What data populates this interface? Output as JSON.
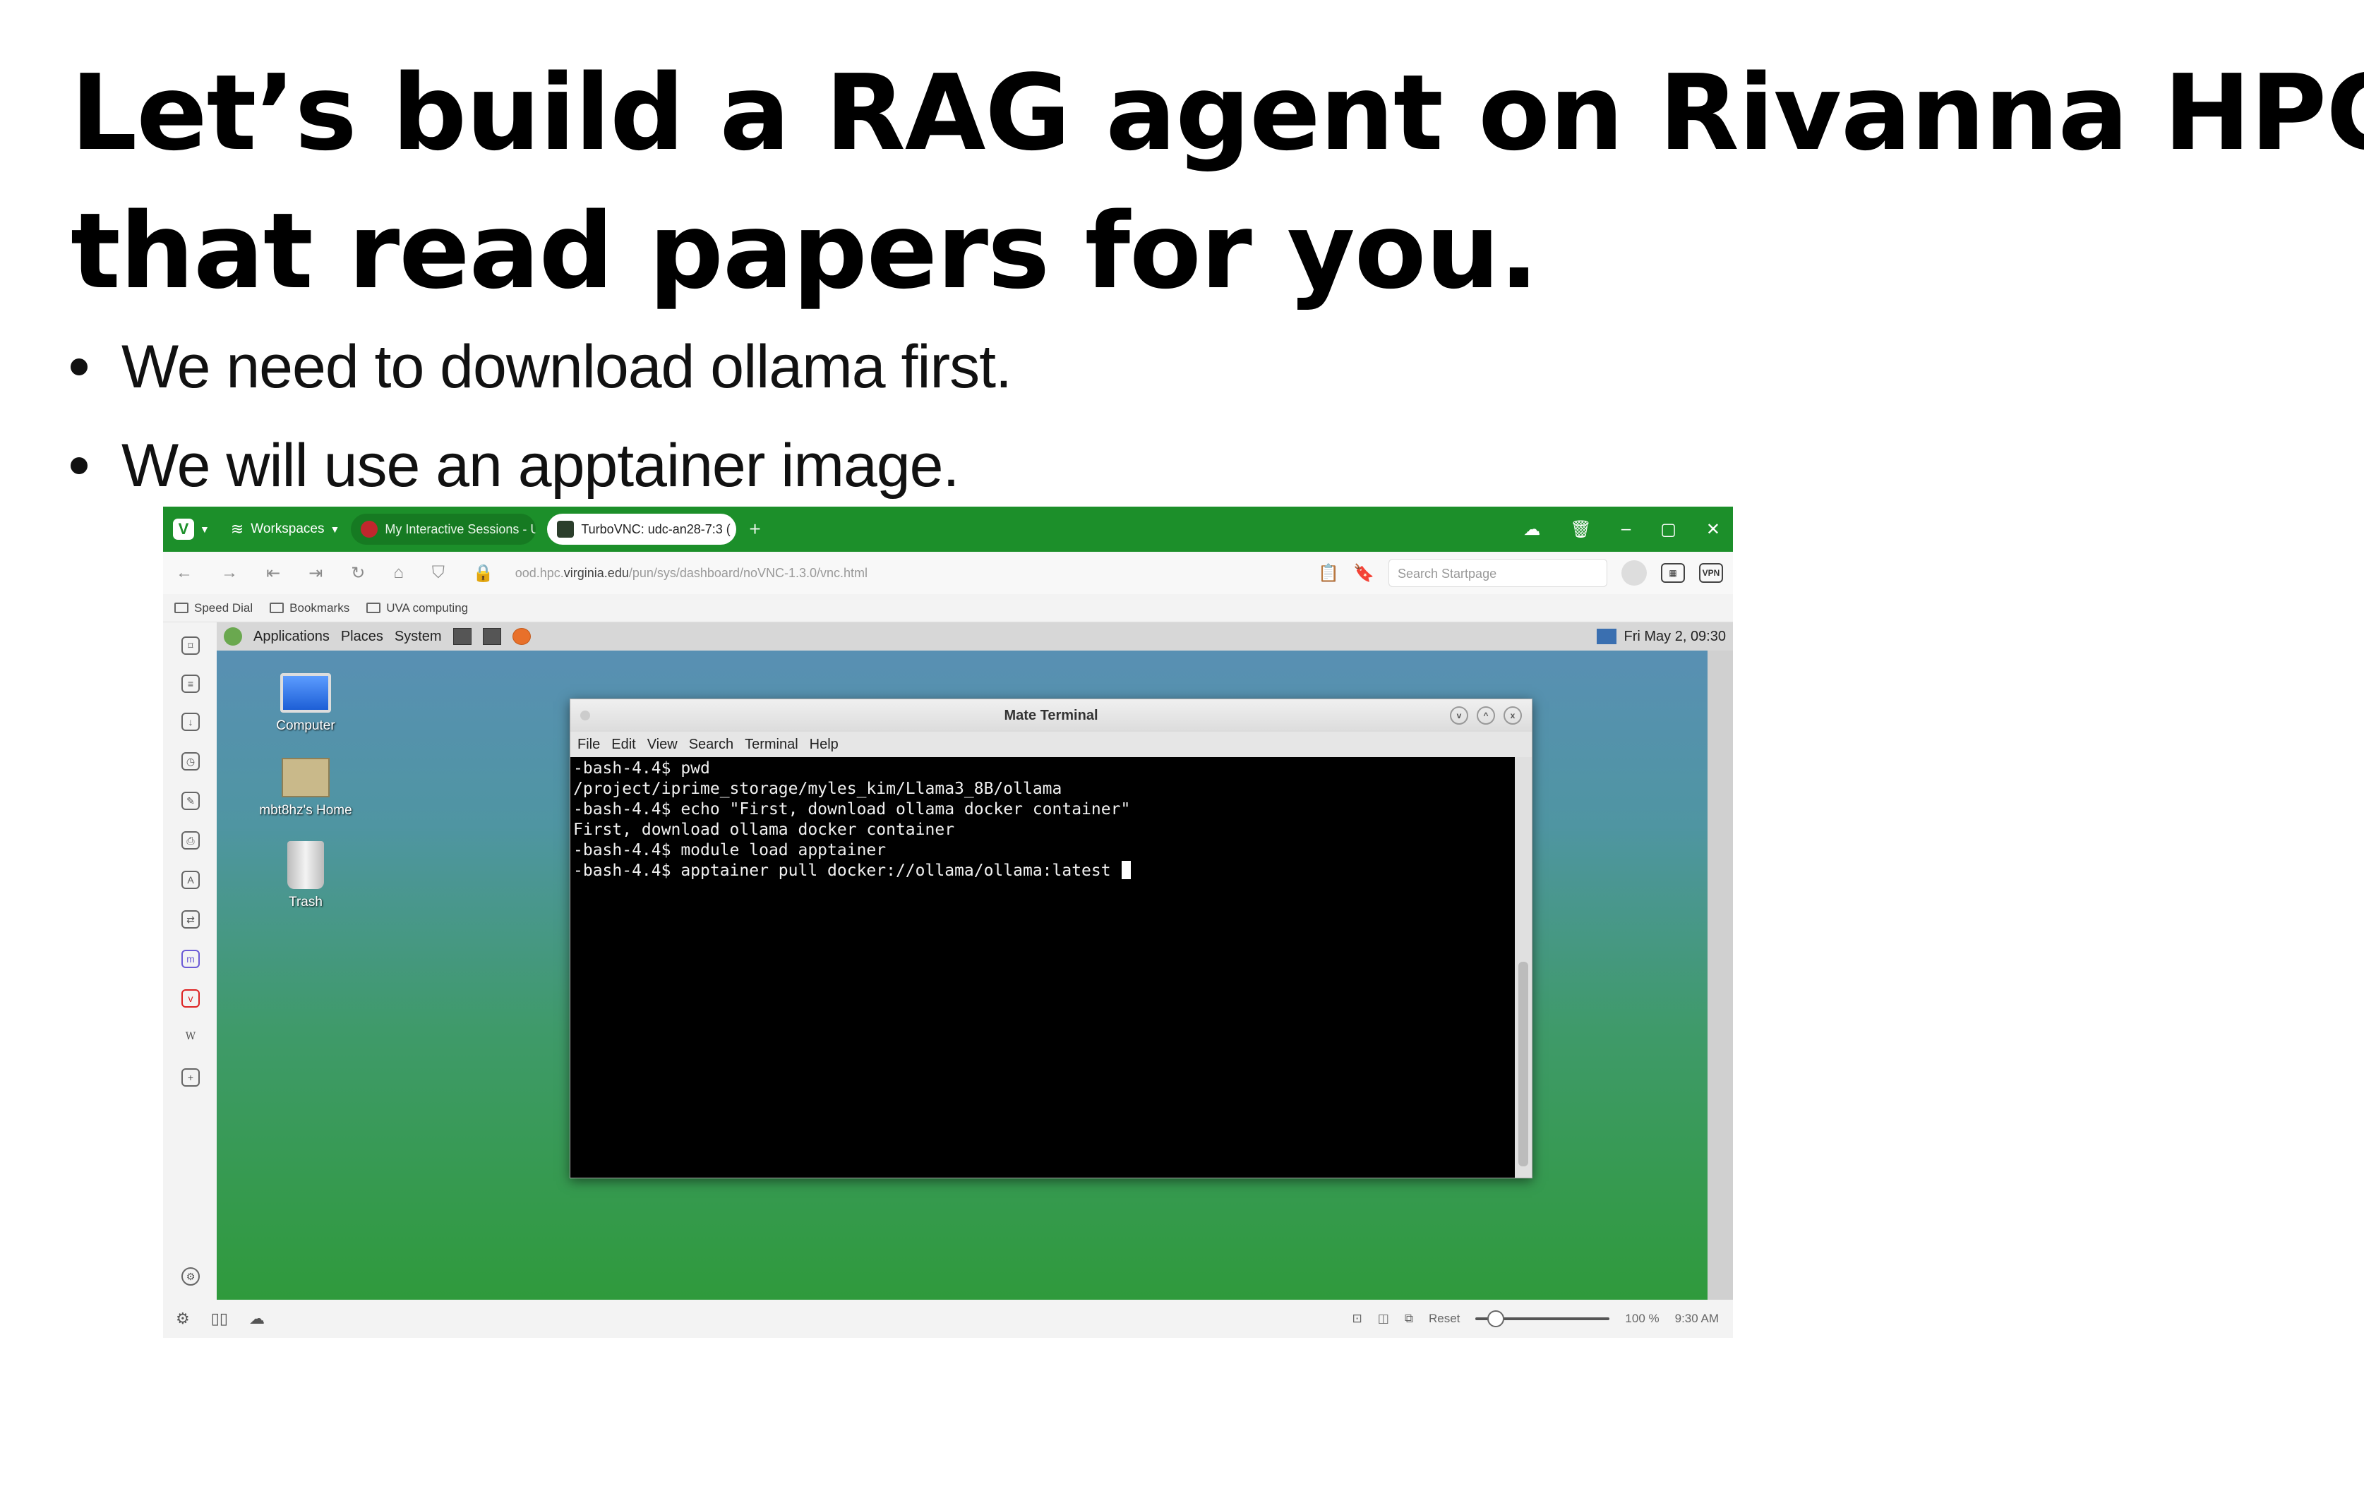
{
  "slide": {
    "title_line1": "Let’s build a RAG agent on Rivanna HPC",
    "title_line2": "that read papers for you.",
    "bullets": [
      {
        "text": "We need to download ollama first."
      },
      {
        "text": "We will use an apptainer image."
      }
    ]
  },
  "browser": {
    "workspaces_label": "Workspaces",
    "tabs": [
      {
        "label": "My Interactive Sessions - U",
        "active": false
      },
      {
        "label": "TurboVNC: udc-an28-7:3 (",
        "active": true
      }
    ],
    "url_prefix": "ood.hpc.",
    "url_host": "virginia.edu",
    "url_path": "/pun/sys/dashboard/noVNC-1.3.0/vnc.html",
    "search_placeholder": "Search Startpage",
    "vpn_label": "VPN",
    "bookmarks": [
      {
        "label": "Speed Dial"
      },
      {
        "label": "Bookmarks"
      },
      {
        "label": "UVA computing"
      }
    ],
    "status": {
      "reset_label": "Reset",
      "zoom_level": "100 %",
      "zoom_fraction": 0.15,
      "time": "9:30 AM"
    }
  },
  "desktop": {
    "panel_menus": [
      {
        "label": "Applications"
      },
      {
        "label": "Places"
      },
      {
        "label": "System"
      }
    ],
    "clock": "Fri May  2, 09:30",
    "icons": [
      {
        "label": "Computer"
      },
      {
        "label": "mbt8hz's Home"
      },
      {
        "label": "Trash"
      }
    ]
  },
  "terminal": {
    "title": "Mate Terminal",
    "menu": [
      {
        "label": "File"
      },
      {
        "label": "Edit"
      },
      {
        "label": "View"
      },
      {
        "label": "Search"
      },
      {
        "label": "Terminal"
      },
      {
        "label": "Help"
      }
    ],
    "lines": [
      "-bash-4.4$ pwd",
      "/project/iprime_storage/myles_kim/Llama3_8B/ollama",
      "-bash-4.4$ echo \"First, download ollama docker container\"",
      "First, download ollama docker container",
      "-bash-4.4$ module load apptainer",
      "-bash-4.4$ apptainer pull docker://ollama/ollama:latest "
    ]
  },
  "colors": {
    "browser_accent": "#1c8f2a",
    "terminal_bg": "#000000"
  }
}
